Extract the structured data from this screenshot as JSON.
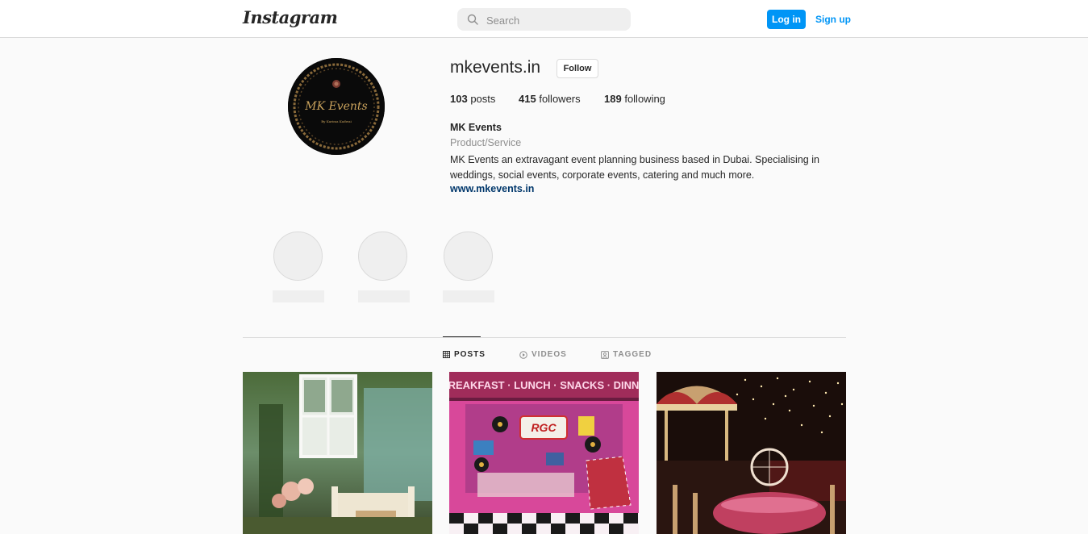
{
  "header": {
    "logo": "Instagram",
    "search_placeholder": "Search",
    "login_label": "Log in",
    "signup_label": "Sign up",
    "accent_color": "#0095f6"
  },
  "profile": {
    "username": "mkevents.in",
    "follow_label": "Follow",
    "stats": {
      "posts_count": "103",
      "posts_label": "posts",
      "followers_count": "415",
      "followers_label": "followers",
      "following_count": "189",
      "following_label": "following"
    },
    "name": "MK Events",
    "category": "Product/Service",
    "bio": "MK Events an extravagant event planning business based in Dubai. Specialising in weddings, social events, corporate events, catering and much more.",
    "website": "www.mkevents.in",
    "avatar_text": "MK Events",
    "avatar_subtext": "By Karima Kadwai"
  },
  "tabs": [
    {
      "label": "POSTS",
      "icon": "grid-icon",
      "active": true
    },
    {
      "label": "VIDEOS",
      "icon": "play-icon",
      "active": false
    },
    {
      "label": "TAGGED",
      "icon": "tag-icon",
      "active": false
    }
  ],
  "posts": [
    {
      "name": "garden-window-setup"
    },
    {
      "name": "diner-themed-booth",
      "sign_text": "RGC",
      "banner_text": "REAKFAST · LUNCH · SNACKS · DINN"
    },
    {
      "name": "carnival-tent-dinner"
    }
  ]
}
